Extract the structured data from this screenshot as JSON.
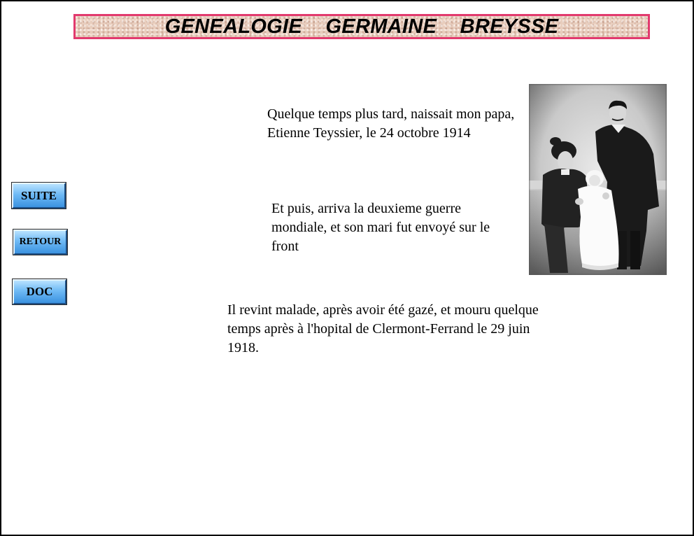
{
  "header": {
    "title": "GENEALOGIE    GERMAINE    BREYSSE"
  },
  "nav": {
    "suite_label": "SUITE",
    "retour_label": "RETOUR",
    "doc_label": "DOC"
  },
  "content": {
    "paragraph_1": "Quelque temps plus tard, naissait mon papa, Etienne Teyssier, le 24 octobre 1914",
    "paragraph_2": "Et puis, arriva la deuxieme guerre mondiale, et son mari fut envoyé sur le front",
    "paragraph_3": "Il revint malade, après avoir été gazé, et mouru quelque temps après à l'hopital de Clermont-Ferrand le 29 juin 1918."
  },
  "colors": {
    "banner_border": "#e23a6e",
    "banner_fill": "#e8cdbd",
    "button_face": "#6fbaf5"
  }
}
